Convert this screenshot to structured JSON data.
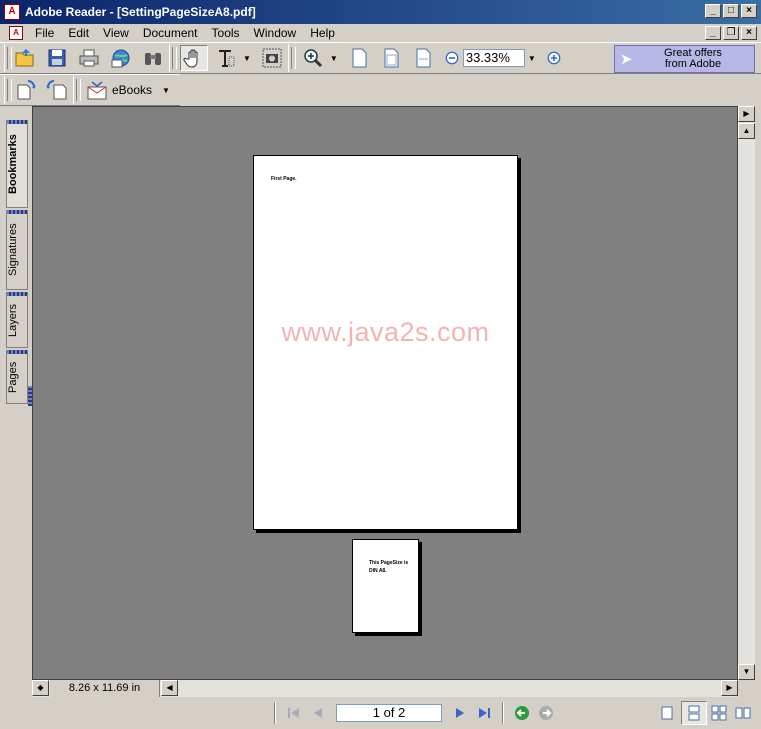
{
  "window": {
    "title": "Adobe Reader - [SettingPageSizeA8.pdf]",
    "app_icon_glyph": "A",
    "minimize_glyph": "_",
    "maximize_glyph": "□",
    "close_glyph": "×",
    "restore_glyph": "❐"
  },
  "menu": {
    "items": [
      "File",
      "Edit",
      "View",
      "Document",
      "Tools",
      "Window",
      "Help"
    ]
  },
  "toolbar": {
    "zoom_value": "33.33%",
    "dropdown_glyph": "▼",
    "offer_line": "Great offers\nfrom Adobe",
    "ebooks_label": "eBooks"
  },
  "nav_tabs": [
    "Bookmarks",
    "Signatures",
    "Layers",
    "Pages"
  ],
  "document": {
    "page1_text": "First Page.",
    "page2_text": "This PageSize is DIN A8.",
    "watermark": "www.java2s.com"
  },
  "status": {
    "page_size": "8.26 x 11.69 in",
    "page_indicator": "1 of 2"
  },
  "colors": {
    "titlebar": "#0a246a",
    "doc_background": "#808080",
    "offer_background": "#b7b7e8",
    "watermark": "#f2b3b3"
  }
}
